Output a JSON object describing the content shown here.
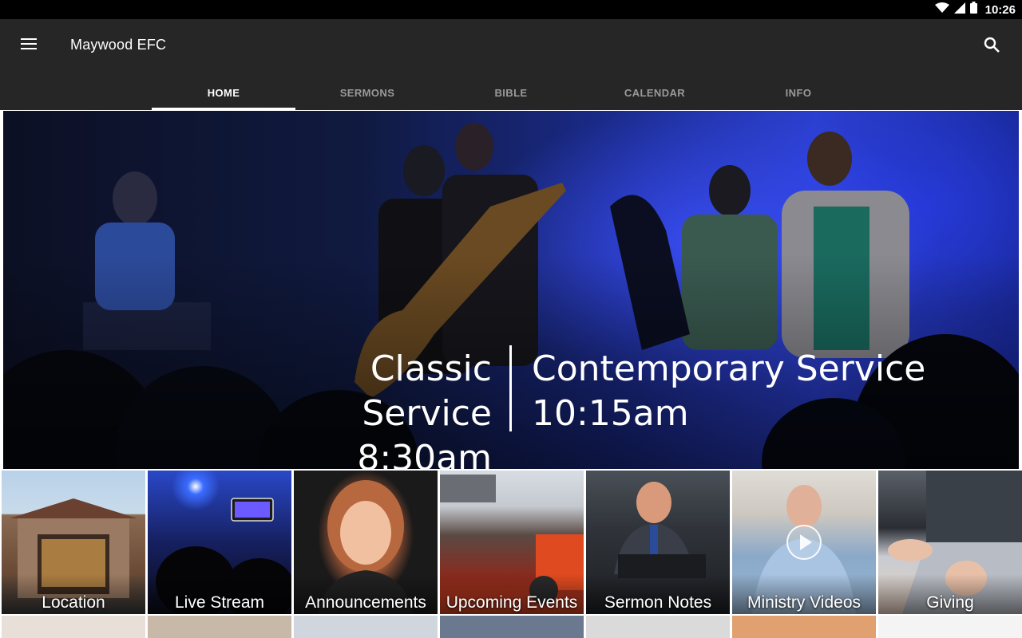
{
  "status_bar": {
    "time": "10:26",
    "icons": [
      "wifi-icon",
      "signal-icon",
      "battery-icon"
    ]
  },
  "app_bar": {
    "title": "Maywood EFC",
    "menu_icon": "menu-icon",
    "search_icon": "search-icon",
    "tabs": [
      {
        "label": "HOME",
        "active": true
      },
      {
        "label": "SERMONS",
        "active": false
      },
      {
        "label": "BIBLE",
        "active": false
      },
      {
        "label": "CALENDAR",
        "active": false
      },
      {
        "label": "INFO",
        "active": false
      }
    ]
  },
  "hero": {
    "left_title": "Classic Service",
    "left_time": "8:30am",
    "right_title": "Contemporary Service",
    "right_time": "10:15am"
  },
  "tiles": [
    {
      "label": "Location"
    },
    {
      "label": "Live Stream"
    },
    {
      "label": "Announcements"
    },
    {
      "label": "Upcoming Events"
    },
    {
      "label": "Sermon Notes"
    },
    {
      "label": "Ministry Videos"
    },
    {
      "label": "Giving"
    }
  ],
  "colors": {
    "app_bar": "#262626",
    "status_bar": "#000000",
    "tab_active": "#ffffff",
    "tab_inactive": "#9a9a9a"
  }
}
